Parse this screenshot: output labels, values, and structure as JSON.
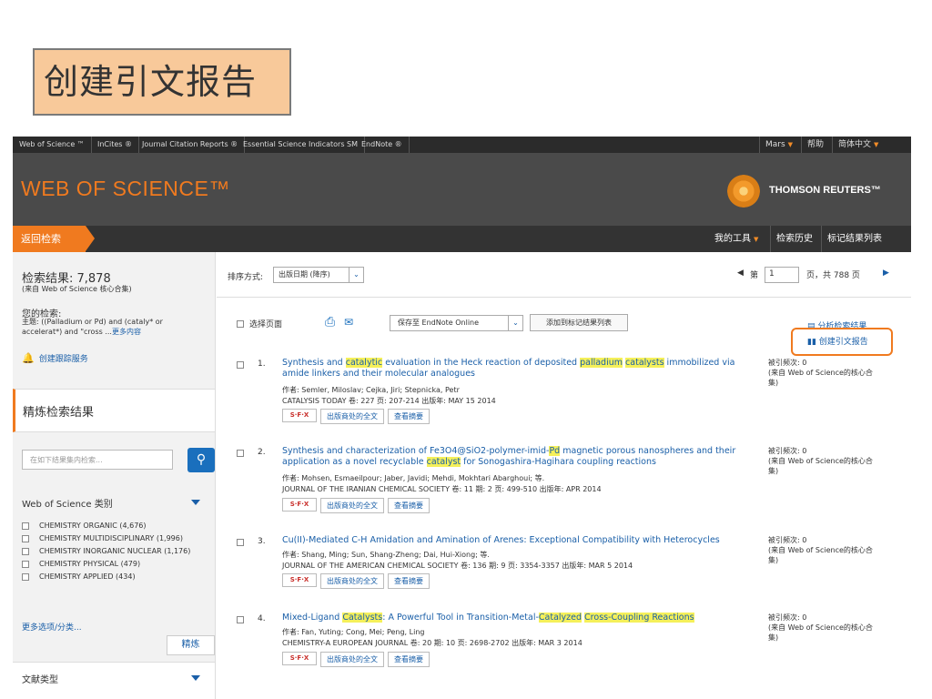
{
  "slide_title": "创建引文报告",
  "topbar": {
    "links": [
      "Web of Science ™",
      "InCites ®",
      "Journal Citation Reports ®",
      "Essential Science Indicators SM",
      "EndNote ®"
    ],
    "user": "Mars",
    "help": "帮助",
    "language": "简体中文"
  },
  "header": {
    "wos_logo": "WEB OF SCIENCE™",
    "tr_logo": "THOMSON REUTERS™"
  },
  "navbar": {
    "back": "返回检索",
    "my_tools": "我的工具",
    "search_history": "检索历史",
    "marked_list": "标记结果列表"
  },
  "left": {
    "results_label": "检索结果: 7,878",
    "results_source": "(来自 Web of Science 核心合集)",
    "query_head": "您的检索:",
    "query_text": "主题: ((Palladium or Pd) and (cataly* or accelerat*) and \"cross ...",
    "query_more": "更多内容",
    "alert": "创建跟踪服务",
    "refine_header": "精炼检索结果",
    "search_placeholder": "在如下结果集内检索...",
    "category_header": "Web of Science 类别",
    "categories": [
      "CHEMISTRY ORGANIC (4,676)",
      "CHEMISTRY MULTIDISCIPLINARY (1,996)",
      "CHEMISTRY INORGANIC NUCLEAR (1,176)",
      "CHEMISTRY PHYSICAL (479)",
      "CHEMISTRY APPLIED (434)"
    ],
    "more_options": "更多选项/分类...",
    "refine_button": "精炼",
    "doctype_header": "文献类型"
  },
  "sortbar": {
    "sort_label": "排序方式:",
    "sort_value": "出版日期 (降序)",
    "page_prefix": "第",
    "page_value": "1",
    "page_suffix": "页，共  788  页"
  },
  "toolbar": {
    "select_page": "选择页面",
    "save_to": "保存至 EndNote Online",
    "add_marked": "添加到标记结果列表",
    "analyze": "分析检索结果",
    "citation_report": "创建引文报告"
  },
  "records": [
    {
      "num": "1.",
      "title_parts": [
        [
          "Synthesis and ",
          false
        ],
        [
          "catalytic",
          true
        ],
        [
          " evaluation in the Heck reaction of deposited ",
          false
        ],
        [
          "palladium",
          true
        ],
        [
          " ",
          false
        ],
        [
          "catalysts",
          true
        ],
        [
          " immobilized via amide linkers and their molecular analogues",
          false
        ]
      ],
      "authors": "作者: Semler, Miloslav; Cejka, Jiri; Stepnicka, Petr",
      "source": "CATALYSIS TODAY  卷: 227  页: 207-214  出版年: MAY 15 2014",
      "cites": "被引频次: 0\n(来自 Web of Science的核心合集)"
    },
    {
      "num": "2.",
      "title_parts": [
        [
          "Synthesis and characterization of Fe3O4@SiO2-polymer-imid-",
          false
        ],
        [
          "Pd",
          true
        ],
        [
          " magnetic porous nanospheres and their application as a novel recyclable ",
          false
        ],
        [
          "catalyst",
          true
        ],
        [
          " for Sonogashira-Hagihara coupling reactions",
          false
        ]
      ],
      "authors": "作者: Mohsen, Esmaeilpour; Jaber, Javidi; Mehdi, Mokhtari Abarghoui; 等.",
      "source": "JOURNAL OF THE IRANIAN CHEMICAL SOCIETY  卷: 11  期: 2  页: 499-510  出版年: APR 2014",
      "cites": "被引频次: 0\n(来自 Web of Science的核心合集)"
    },
    {
      "num": "3.",
      "title_parts": [
        [
          "Cu(II)-Mediated C-H Amidation and Amination of Arenes: Exceptional Compatibility with Heterocycles",
          false
        ]
      ],
      "authors": "作者: Shang, Ming; Sun, Shang-Zheng; Dai, Hui-Xiong; 等.",
      "source": "JOURNAL OF THE AMERICAN CHEMICAL SOCIETY  卷: 136  期: 9  页: 3354-3357  出版年: MAR 5 2014",
      "cites": "被引频次: 0\n(来自 Web of Science的核心合集)"
    },
    {
      "num": "4.",
      "title_parts": [
        [
          "Mixed-Ligand ",
          false
        ],
        [
          "Catalysts",
          true
        ],
        [
          ": A Powerful Tool in Transition-Metal-",
          false
        ],
        [
          "Catalyzed",
          true
        ],
        [
          " ",
          false
        ],
        [
          "Cross-Coupling Reactions",
          true
        ]
      ],
      "authors": "作者: Fan, Yuting; Cong, Mei; Peng, Ling",
      "source": "CHEMISTRY-A EUROPEAN JOURNAL  卷: 20  期: 10  页: 2698-2702  出版年: MAR 3 2014",
      "cites": "被引频次: 0\n(来自 Web of Science的核心合集)"
    }
  ],
  "record_buttons": {
    "sfx": "S·F·X",
    "fulltext": "出版商处的全文",
    "abstract": "查看摘要"
  },
  "colors": {
    "accent_orange": "#f07a1f",
    "link_blue": "#1a5fa8",
    "highlight_yellow": "#f5f05a",
    "header_gray": "#4a4a4a"
  }
}
